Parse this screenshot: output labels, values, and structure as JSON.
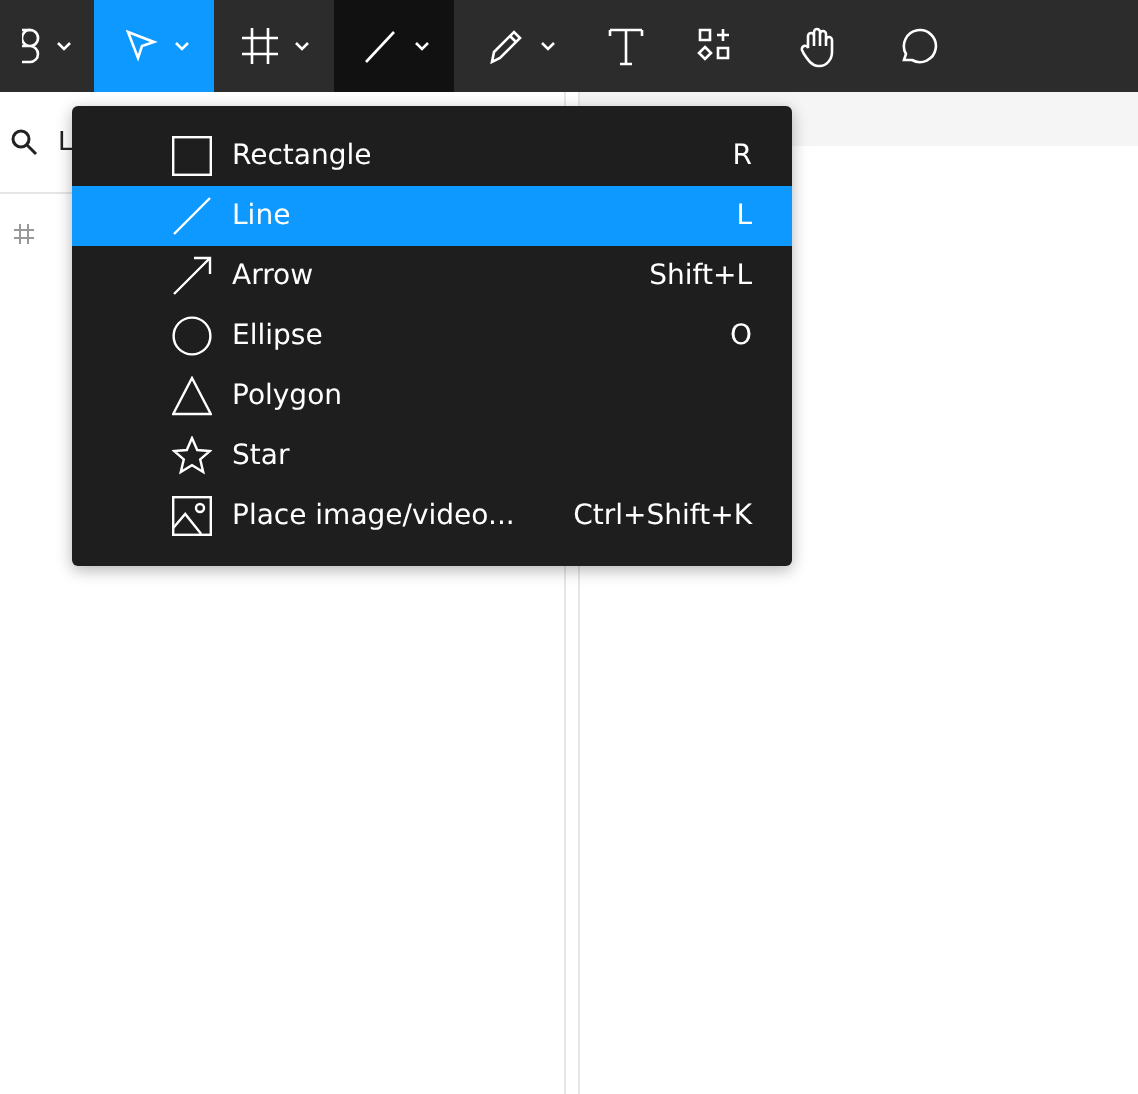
{
  "toolbar": {
    "tools": [
      {
        "kind": "logo",
        "selected": false,
        "open": false,
        "dropdown": true
      },
      {
        "kind": "move",
        "selected": true,
        "open": false,
        "dropdown": true
      },
      {
        "kind": "frame",
        "selected": false,
        "open": false,
        "dropdown": true
      },
      {
        "kind": "line",
        "selected": false,
        "open": true,
        "dropdown": true
      },
      {
        "kind": "pen",
        "selected": false,
        "open": false,
        "dropdown": true
      },
      {
        "kind": "text",
        "selected": false,
        "open": false,
        "dropdown": false
      },
      {
        "kind": "components",
        "selected": false,
        "open": false,
        "dropdown": false
      },
      {
        "kind": "hand",
        "selected": false,
        "open": false,
        "dropdown": false
      },
      {
        "kind": "comment",
        "selected": false,
        "open": false,
        "dropdown": false
      }
    ]
  },
  "layers_panel": {
    "search": {
      "value": "L"
    }
  },
  "shape_menu": {
    "items": [
      {
        "kind": "rectangle",
        "label": "Rectangle",
        "shortcut": "R",
        "selected": false
      },
      {
        "kind": "line",
        "label": "Line",
        "shortcut": "L",
        "selected": true
      },
      {
        "kind": "arrow",
        "label": "Arrow",
        "shortcut": "Shift+L",
        "selected": false
      },
      {
        "kind": "ellipse",
        "label": "Ellipse",
        "shortcut": "O",
        "selected": false
      },
      {
        "kind": "polygon",
        "label": "Polygon",
        "selected": false
      },
      {
        "kind": "star",
        "label": "Star",
        "selected": false
      },
      {
        "kind": "image",
        "label": "Place image/video...",
        "shortcut": "Ctrl+Shift+K",
        "selected": false
      }
    ]
  }
}
